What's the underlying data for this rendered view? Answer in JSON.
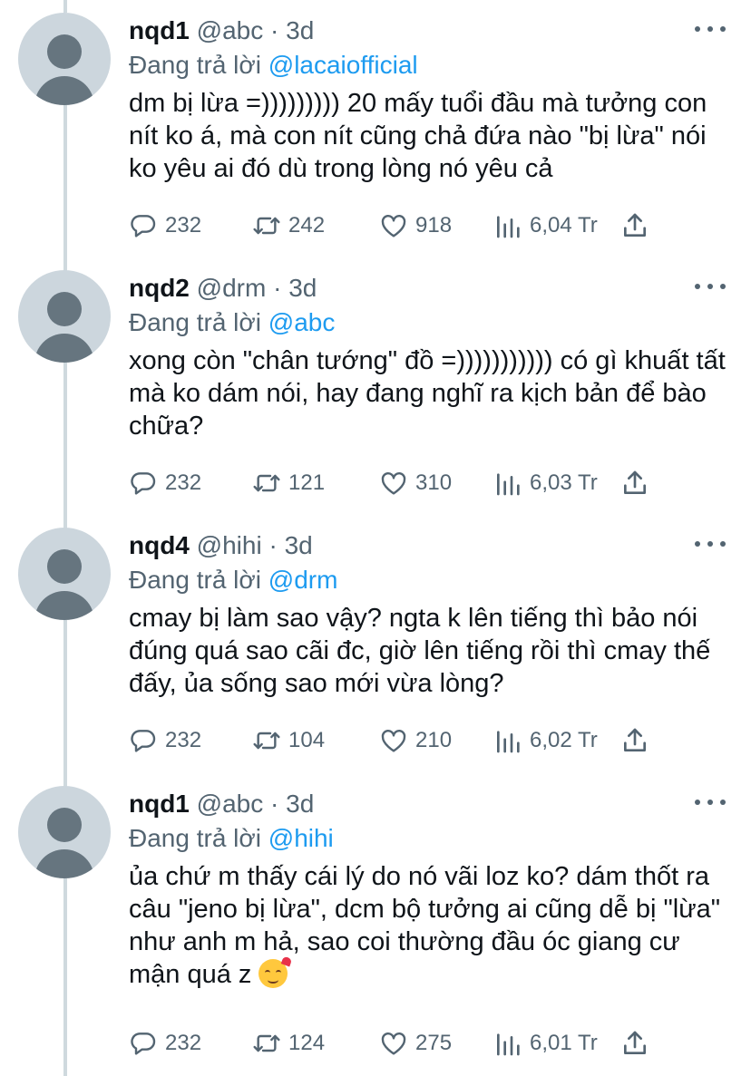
{
  "tweets": [
    {
      "name": "nqd1",
      "handle": "@abc",
      "time": "3d",
      "reply_prefix": "Đang trả lời",
      "reply_to": "@lacaiofficial",
      "text": "dm bị lừa =))))))))) 20 mấy tuổi đầu mà tưởng con nít ko á, mà con nít cũng chả đứa nào \"bị lừa\" nói ko yêu ai đó dù trong lòng nó yêu cả",
      "replies": "232",
      "retweets": "242",
      "likes": "918",
      "views": "6,04 Tr"
    },
    {
      "name": "nqd2",
      "handle": "@drm",
      "time": "3d",
      "reply_prefix": "Đang trả lời",
      "reply_to": "@abc",
      "text": "xong còn \"chân tướng\" đồ =))))))))))) có gì khuất tất mà ko dám nói, hay đang nghĩ ra kịch bản để bào chữa?",
      "replies": "232",
      "retweets": "121",
      "likes": "310",
      "views": "6,03 Tr"
    },
    {
      "name": "nqd4",
      "handle": "@hihi",
      "time": "3d",
      "reply_prefix": "Đang trả lời",
      "reply_to": "@drm",
      "text": "cmay bị làm sao vậy? ngta k lên tiếng thì bảo nói đúng quá sao cãi đc, giờ lên tiếng rồi thì cmay thế đấy, ủa sống sao mới vừa lòng?",
      "replies": "232",
      "retweets": "104",
      "likes": "210",
      "views": "6,02 Tr"
    },
    {
      "name": "nqd1",
      "handle": "@abc",
      "time": "3d",
      "reply_prefix": "Đang trả lời",
      "reply_to": "@hihi",
      "text": "ủa chứ m thấy cái lý do nó vãi loz ko? dám thốt ra câu \"jeno bị lừa\", dcm bộ tưởng ai cũng dễ bị \"lừa\" như anh m hả, sao coi thường đầu óc giang cư mận quá z",
      "replies": "232",
      "retweets": "124",
      "likes": "275",
      "views": "6,01 Tr"
    }
  ],
  "icons": {
    "reply": "speech-bubble",
    "retweet": "retweet-arrows",
    "like": "heart",
    "views": "bar-chart",
    "share": "upload-arrow",
    "more": "three-dots",
    "emoji": "smiling-face-with-hearts"
  },
  "colors": {
    "link": "#1d9bf0",
    "secondary_text": "#536471",
    "thread_line": "#cfd9de"
  }
}
